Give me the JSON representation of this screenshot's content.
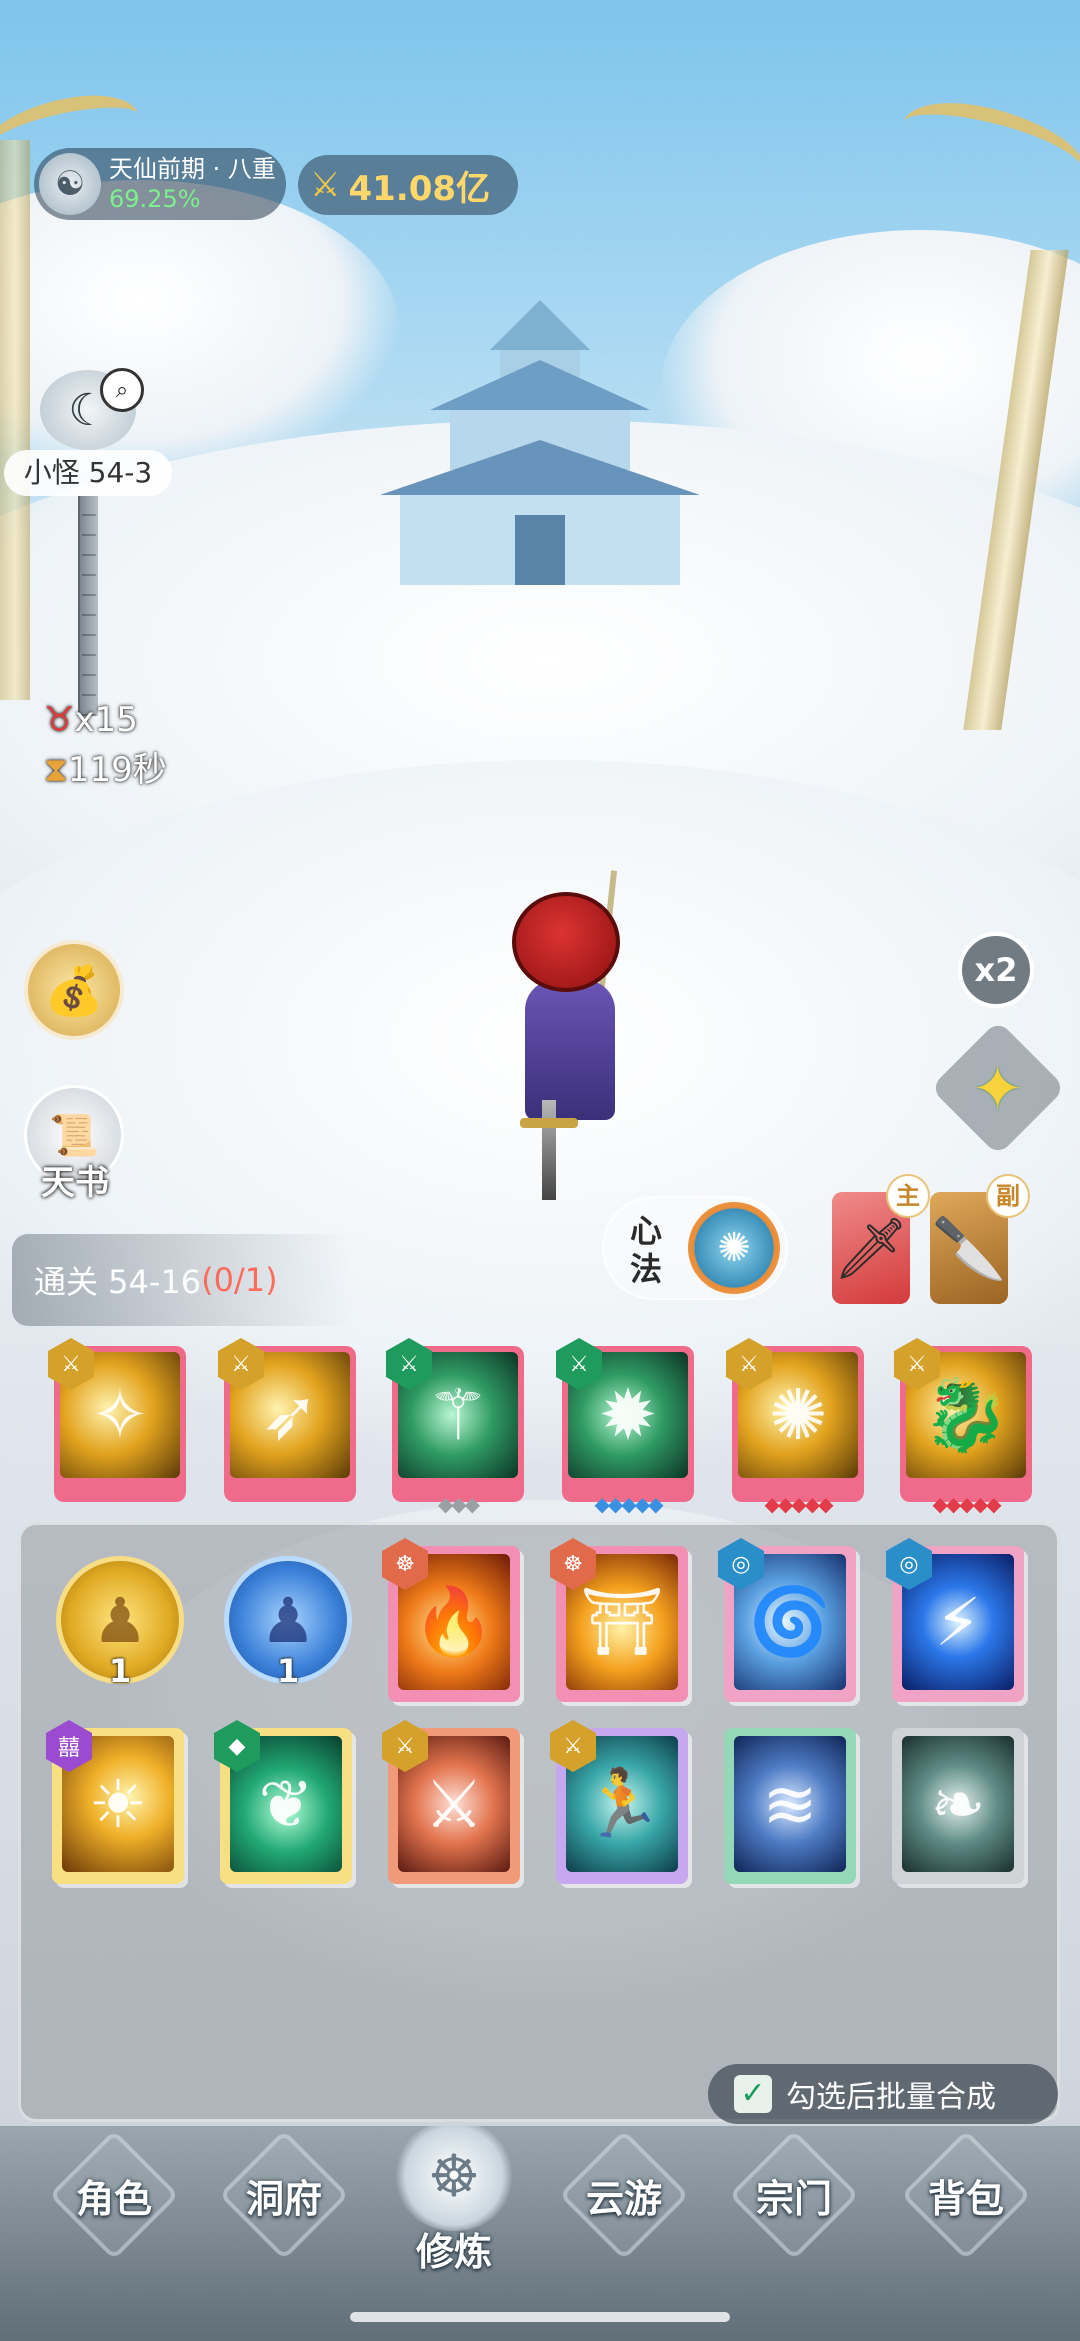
{
  "header": {
    "realm_name": "天仙前期 · 八重",
    "realm_progress": "69.25%",
    "combat_power": "41.08亿",
    "power_icon": "crossed-swords-icon"
  },
  "stage": {
    "label": "小怪 54-3",
    "kills": "x15",
    "timer": "119秒"
  },
  "side": {
    "book_label": "天书",
    "speed_label": "x2"
  },
  "quest": {
    "text": "通关 54-16",
    "progress": "(0/1)"
  },
  "xinfa": {
    "label": "心法"
  },
  "weapons": {
    "main_tag": "主",
    "sub_tag": "副"
  },
  "equipped_skills": [
    {
      "badge": "gold",
      "art": "gold",
      "stars": ""
    },
    {
      "badge": "gold",
      "art": "gold",
      "stars": ""
    },
    {
      "badge": "green",
      "art": "green",
      "stars": "◆◆◆"
    },
    {
      "badge": "green",
      "art": "green",
      "stars": "◆◆◆◆◆"
    },
    {
      "badge": "gold",
      "art": "gold",
      "stars": "◆◆◆◆◆"
    },
    {
      "badge": "gold",
      "art": "gold",
      "stars": "◆◆◆◆◆"
    }
  ],
  "inventory": {
    "gold_coin_count": "1",
    "blue_coin_count": "1",
    "batch_label": "勾选后批量合成"
  },
  "nav": {
    "items": [
      "角色",
      "洞府",
      "修炼",
      "云游",
      "宗门",
      "背包"
    ],
    "active": "修炼"
  }
}
